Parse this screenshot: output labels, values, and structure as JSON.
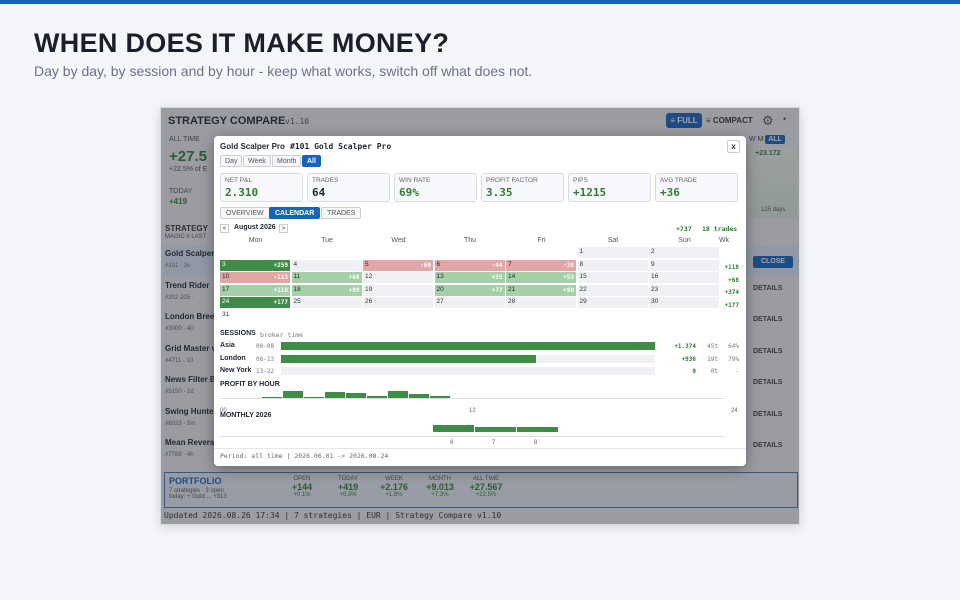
{
  "hero": {
    "title": "WHEN DOES IT MAKE MONEY?",
    "subtitle": "Day by day, by session and by hour - keep what works, switch off what does not."
  },
  "app": {
    "title": "STRATEGY COMPARE",
    "version": "v1.10",
    "view_full": "≡ FULL",
    "view_compact": "≡ COMPACT",
    "all_time_label": "ALL TIME",
    "all_time_value": "+27.5",
    "all_time_pct": "+22.5% of E",
    "today_label": "TODAY",
    "today_value": "+419",
    "mini_tabs": "W  M",
    "mini_all": "ALL",
    "mini_value": "+23.172",
    "mini_axis": "125 days",
    "strategy_label": "STRATEGY",
    "magic_label": "MAGIC #  LAST",
    "close_label": "CLOSE",
    "details_label": "DETAILS",
    "rows": [
      {
        "name": "Gold Scalper",
        "sub": "#101  ·  3s"
      },
      {
        "name": "Trend Rider",
        "sub": "#202 205  ·"
      },
      {
        "name": "London Bree",
        "sub": "#3000  ·  40"
      },
      {
        "name": "Grid Master v",
        "sub": "#4711  ·  10"
      },
      {
        "name": "News Filter B",
        "sub": "#5150  ·  1d"
      },
      {
        "name": "Swing Hunte",
        "sub": "#6023  ·  5m"
      },
      {
        "name": "Mean Revers",
        "sub": "#7788  ·  4h"
      }
    ],
    "portfolio": {
      "title": "PORTFOLIO",
      "sub1": "7 strategies   ·   3 open",
      "sub2": "today: + Gold ... +313",
      "cols": [
        {
          "h": "OPEN",
          "v": "+144",
          "p": "+0.1%"
        },
        {
          "h": "TODAY",
          "v": "+419",
          "p": "+0.3%"
        },
        {
          "h": "WEEK",
          "v": "+2.176",
          "p": "+1.8%"
        },
        {
          "h": "MONTH",
          "v": "+9.013",
          "p": "+7.3%"
        },
        {
          "h": "ALL TIME",
          "v": "+27.567",
          "p": "+22.5%"
        }
      ]
    },
    "status": "Updated 2026.08.26 17:34   |   7 strategies   |   EUR   |   Strategy Compare v1.10"
  },
  "modal": {
    "name": "Gold Scalper Pro",
    "id": "#101  Gold Scalper Pro",
    "close": "x",
    "periods": [
      "Day",
      "Week",
      "Month",
      "All"
    ],
    "kpis": [
      {
        "label": "NET P&L",
        "value": "2.310"
      },
      {
        "label": "TRADES",
        "value": "64"
      },
      {
        "label": "WIN RATE",
        "value": "69%"
      },
      {
        "label": "PROFIT FACTOR",
        "value": "3.35"
      },
      {
        "label": "PIPS",
        "value": "+1215"
      },
      {
        "label": "AVG TRADE",
        "value": "+36"
      }
    ],
    "tabs": [
      "OVERVIEW",
      "CALENDAR",
      "TRADES"
    ],
    "nav_prev": "<",
    "nav_next": ">",
    "month_label": "August 2026",
    "month_total": "+737",
    "month_trades": "18 trades",
    "weekdays": [
      "Mon",
      "Tue",
      "Wed",
      "Thu",
      "Fri",
      "Sat",
      "Sun",
      "Wk"
    ],
    "week_totals": [
      "+118",
      "+68",
      "+374",
      "+177"
    ],
    "days": [
      {
        "d": "1",
        "p": "",
        "t": "none"
      },
      {
        "d": "2",
        "p": "",
        "t": "none"
      },
      {
        "d": "3",
        "p": "+259",
        "t": "pos-strong"
      },
      {
        "d": "4",
        "p": "",
        "t": "none"
      },
      {
        "d": "5",
        "p": "-60",
        "t": "neg"
      },
      {
        "d": "6",
        "p": "-44",
        "t": "neg"
      },
      {
        "d": "7",
        "p": "-38",
        "t": "neg"
      },
      {
        "d": "8",
        "p": "",
        "t": "none"
      },
      {
        "d": "9",
        "p": "",
        "t": "none"
      },
      {
        "d": "10",
        "p": "-113",
        "t": "neg"
      },
      {
        "d": "11",
        "p": "+68",
        "t": "pos-light"
      },
      {
        "d": "12",
        "p": "",
        "t": "none"
      },
      {
        "d": "13",
        "p": "+59",
        "t": "pos-light"
      },
      {
        "d": "14",
        "p": "+53",
        "t": "pos-light"
      },
      {
        "d": "15",
        "p": "",
        "t": "none"
      },
      {
        "d": "16",
        "p": "",
        "t": "none"
      },
      {
        "d": "17",
        "p": "+118",
        "t": "pos-light"
      },
      {
        "d": "18",
        "p": "+89",
        "t": "pos-light"
      },
      {
        "d": "19",
        "p": "",
        "t": "none"
      },
      {
        "d": "20",
        "p": "+77",
        "t": "pos-light"
      },
      {
        "d": "21",
        "p": "+90",
        "t": "pos-light"
      },
      {
        "d": "22",
        "p": "",
        "t": "none"
      },
      {
        "d": "23",
        "p": "",
        "t": "none"
      },
      {
        "d": "24",
        "p": "+177",
        "t": "pos-strong"
      },
      {
        "d": "25",
        "p": "",
        "t": "none"
      },
      {
        "d": "26",
        "p": "",
        "t": "none"
      },
      {
        "d": "27",
        "p": "",
        "t": "none"
      },
      {
        "d": "28",
        "p": "",
        "t": "none"
      },
      {
        "d": "29",
        "p": "",
        "t": "none"
      },
      {
        "d": "30",
        "p": "",
        "t": "none"
      },
      {
        "d": "31",
        "p": "",
        "t": "empty"
      }
    ],
    "sessions_title": "SESSIONS",
    "sessions_note": "broker time",
    "sessions": [
      {
        "name": "Asia",
        "hours": "00-08",
        "pnl": "+1.374",
        "trades": "45t",
        "win": "64%",
        "share": 1.0
      },
      {
        "name": "London",
        "hours": "08-13",
        "pnl": "+936",
        "trades": "19t",
        "win": "79%",
        "share": 0.681
      },
      {
        "name": "New York",
        "hours": "13-22",
        "pnl": "0",
        "trades": "0t",
        "win": "-",
        "share": 0
      }
    ],
    "hour_title": "PROFIT BY HOUR",
    "hour_axis": [
      "00",
      "12",
      "24"
    ],
    "hour_values": [
      0,
      0,
      2,
      10,
      1,
      8,
      7,
      3,
      10,
      6,
      3,
      0,
      0,
      0,
      0,
      0,
      0,
      0,
      0,
      0,
      0,
      0,
      0,
      0
    ],
    "monthly_title": "MONTHLY 2026",
    "monthly_labels": [
      "6",
      "7",
      "8"
    ],
    "monthly_values": [
      7,
      5,
      5
    ],
    "footer": "Period: all time   |   2026.06.01  ->  2026.08.24",
    "colors": {
      "accent": "#1565c0",
      "positive": "#3f8c46",
      "negative": "#e3a6a6"
    }
  }
}
